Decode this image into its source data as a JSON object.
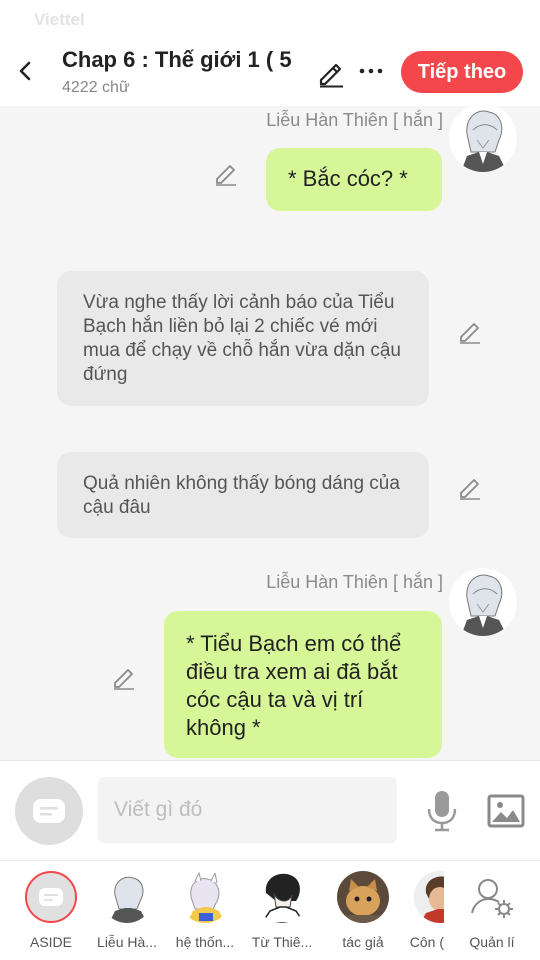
{
  "status_bar": {
    "carrier": "Viettel"
  },
  "header": {
    "title": "Chap 6 : Thế giới 1 ( 5",
    "word_count": "4222 chữ",
    "next_label": "Tiếp theo"
  },
  "messages": [
    {
      "type": "character",
      "name": "Liễu Hàn Thiên [ hắn ]",
      "text": "* Bắc cóc? *"
    },
    {
      "type": "narration",
      "text": "Vừa nghe thấy lời cảnh báo của Tiểu Bạch hắn liền bỏ lại 2 chiếc vé mới mua để chạy về chỗ hắn vừa dặn cậu đứng"
    },
    {
      "type": "narration",
      "text": "Quả nhiên không thấy bóng dáng của cậu đâu"
    },
    {
      "type": "character",
      "name": "Liễu Hàn Thiên [ hắn ]",
      "text": "* Tiểu Bạch em có thể điều tra xem ai đã bắt cóc cậu ta và vị trí không *"
    }
  ],
  "composer": {
    "placeholder": "Viết gì đó"
  },
  "characters": [
    {
      "label": "ASIDE"
    },
    {
      "label": "Liễu Hà..."
    },
    {
      "label": "hệ thốn..."
    },
    {
      "label": "Từ Thiê..."
    },
    {
      "label": "tác giả"
    },
    {
      "label": "Côn ("
    },
    {
      "label": "Quản lí"
    }
  ],
  "colors": {
    "accent": "#f4474b",
    "my_bubble": "#d7f697",
    "narration_bubble": "#e9e9e9"
  }
}
